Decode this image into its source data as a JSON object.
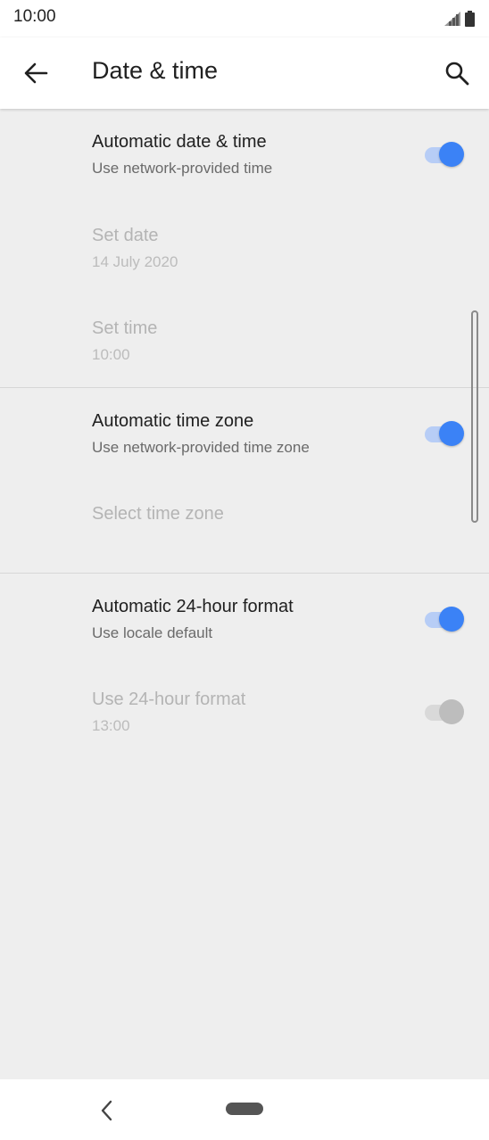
{
  "status_bar": {
    "time": "10:00"
  },
  "app_bar": {
    "title": "Date & time"
  },
  "settings": {
    "auto_date_time": {
      "title": "Automatic date & time",
      "subtitle": "Use network-provided time",
      "enabled": true
    },
    "set_date": {
      "title": "Set date",
      "value": "14 July 2020"
    },
    "set_time": {
      "title": "Set time",
      "value": "10:00"
    },
    "auto_time_zone": {
      "title": "Automatic time zone",
      "subtitle": "Use network-provided time zone",
      "enabled": true
    },
    "select_time_zone": {
      "title": "Select time zone"
    },
    "auto_24h": {
      "title": "Automatic 24-hour format",
      "subtitle": "Use locale default",
      "enabled": true
    },
    "use_24h": {
      "title": "Use 24-hour format",
      "value": "13:00",
      "enabled": false
    }
  },
  "colors": {
    "accent": "#3b82f6",
    "background": "#eeeeee"
  }
}
